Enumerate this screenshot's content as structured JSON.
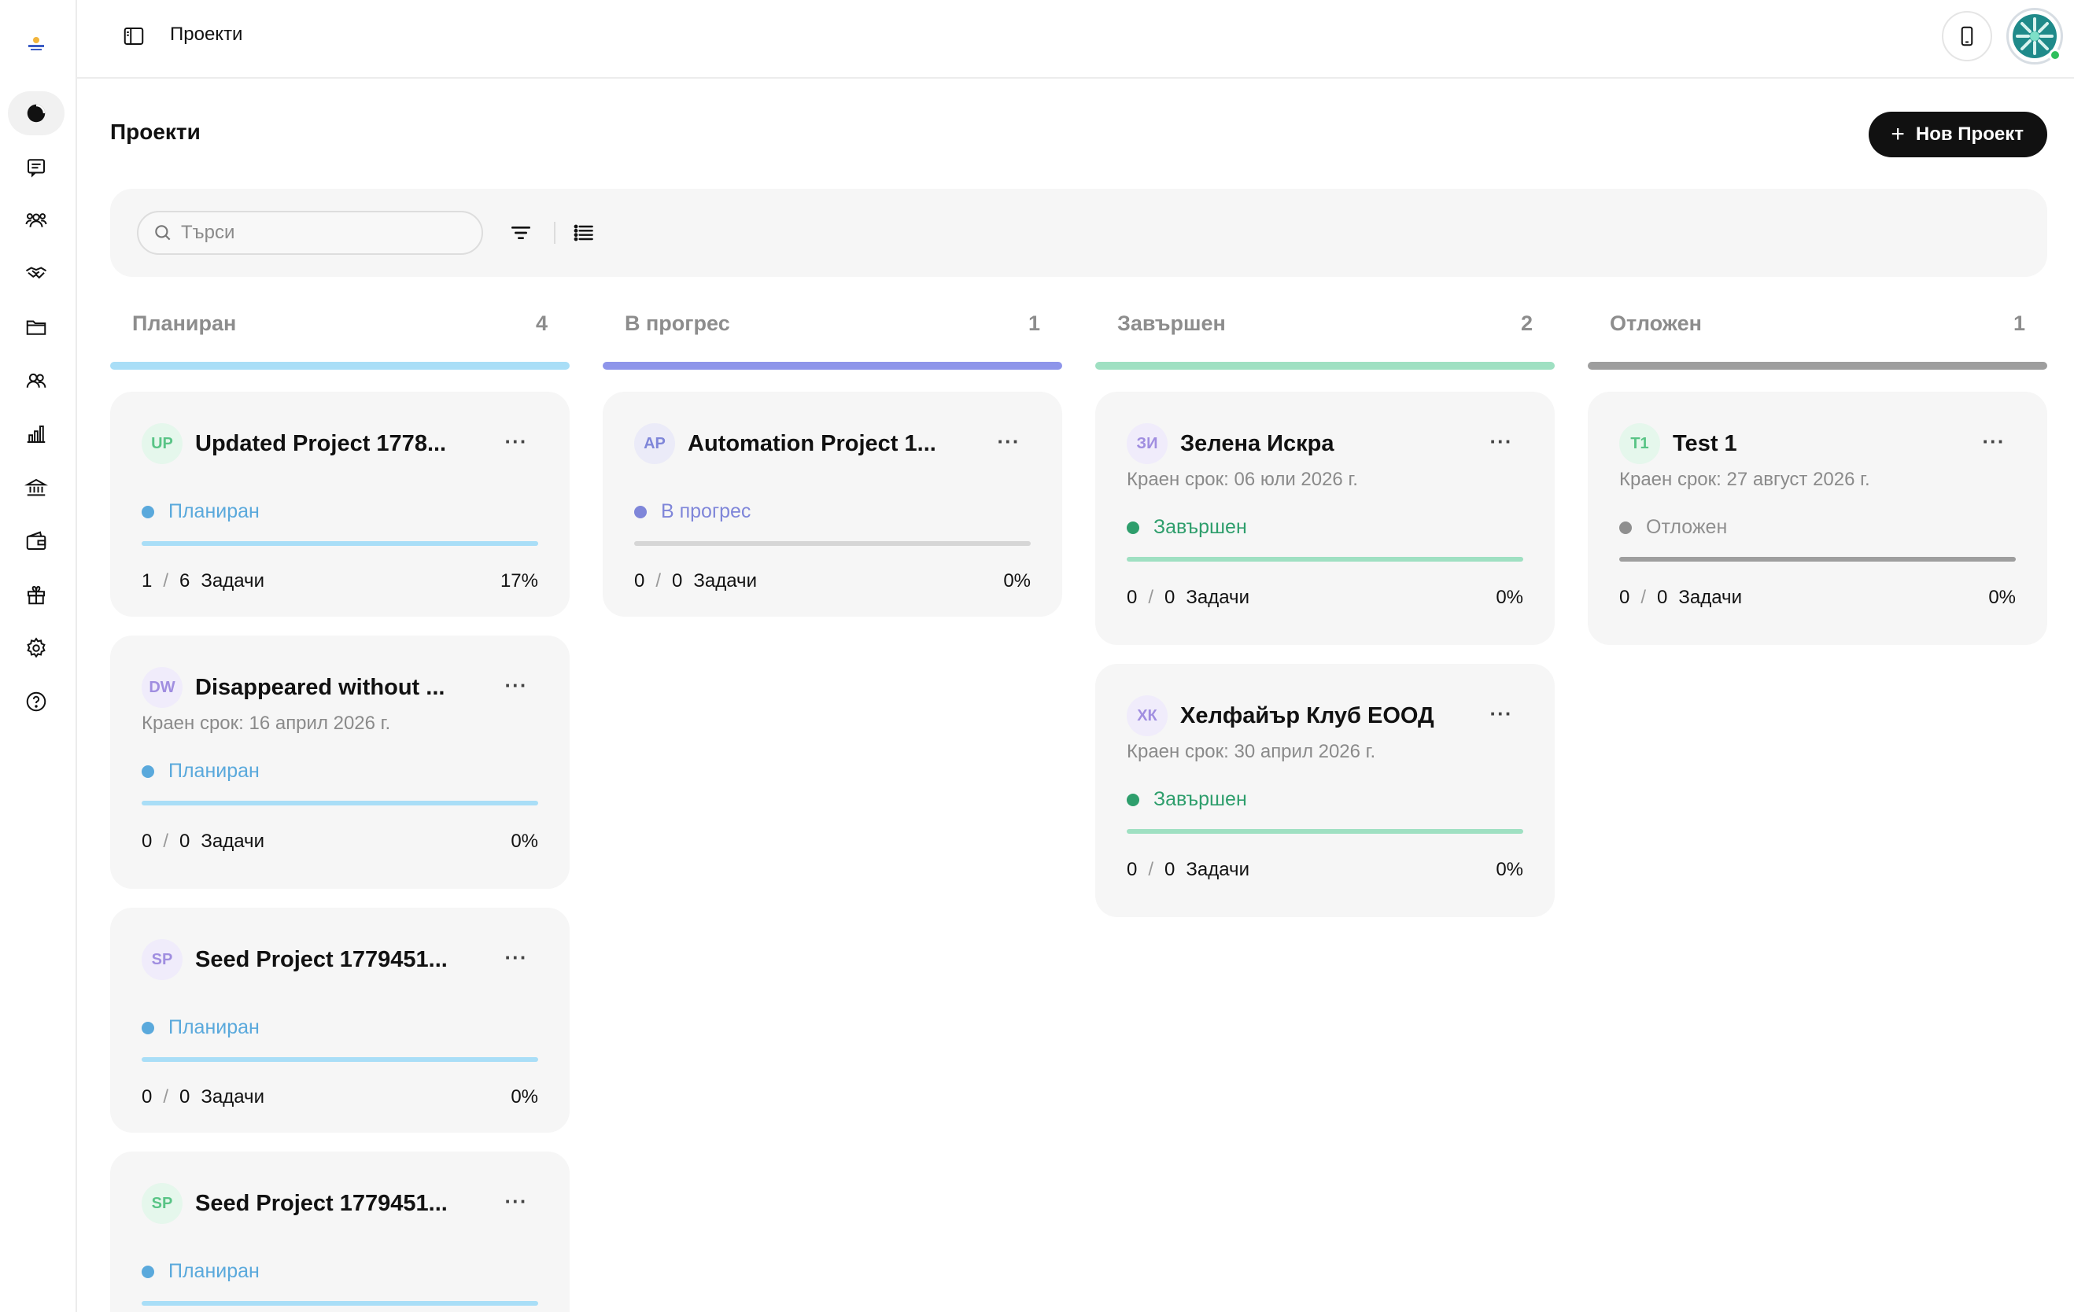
{
  "topbar": {
    "title": "Проекти"
  },
  "page": {
    "title": "Проекти",
    "new_button": "Нов Проект"
  },
  "search": {
    "placeholder": "Търси"
  },
  "colors": {
    "planned": "#5aa9dc",
    "planned_bar": "#a9def7",
    "in_progress": "#7f86d9",
    "in_progress_bar": "#8e95ea",
    "done": "#2e9e6c",
    "done_bar": "#9fe0c2",
    "postponed": "#8f8f8f",
    "postponed_bar": "#9e9e9e"
  },
  "sidebar": {
    "items": [
      {
        "icon": "dashboard-pie-icon",
        "active": true
      },
      {
        "icon": "messages-icon",
        "active": false
      },
      {
        "icon": "team-icon",
        "active": false
      },
      {
        "icon": "handshake-icon",
        "active": false
      },
      {
        "icon": "folder-icon",
        "active": false
      },
      {
        "icon": "users-icon",
        "active": false
      },
      {
        "icon": "bar-chart-icon",
        "active": false
      },
      {
        "icon": "bank-icon",
        "active": false
      },
      {
        "icon": "wallet-icon",
        "active": false
      },
      {
        "icon": "gift-icon",
        "active": false
      },
      {
        "icon": "settings-gear-icon",
        "active": false
      },
      {
        "icon": "help-icon",
        "active": false
      }
    ]
  },
  "columns": [
    {
      "title": "Планиран",
      "count": "4",
      "cards": [
        {
          "initials": "UP",
          "name": "Updated Project 1778...",
          "deadline": "",
          "status": "Планиран",
          "done": "1",
          "total": "6",
          "tasks_label": "Задачи",
          "percent": "17%",
          "progress": 0.17
        },
        {
          "initials": "DW",
          "name": "Disappeared without ...",
          "deadline": "Краен срок: 16 април 2026 г.",
          "status": "Планиран",
          "done": "0",
          "total": "0",
          "tasks_label": "Задачи",
          "percent": "0%",
          "progress": 0
        },
        {
          "initials": "SP",
          "name": "Seed Project 1779451...",
          "deadline": "",
          "status": "Планиран",
          "done": "0",
          "total": "0",
          "tasks_label": "Задачи",
          "percent": "0%",
          "progress": 0
        },
        {
          "initials": "SP",
          "name": "Seed Project 1779451...",
          "deadline": "",
          "status": "Планиран",
          "done": "",
          "total": "",
          "tasks_label": "",
          "percent": "",
          "progress": 0
        }
      ]
    },
    {
      "title": "В прогрес",
      "count": "1",
      "cards": [
        {
          "initials": "AP",
          "name": "Automation Project 1...",
          "deadline": "",
          "status": "В прогрес",
          "done": "0",
          "total": "0",
          "tasks_label": "Задачи",
          "percent": "0%",
          "progress": 0
        }
      ]
    },
    {
      "title": "Завършен",
      "count": "2",
      "cards": [
        {
          "initials": "ЗИ",
          "name": "Зелена Искра",
          "deadline": "Краен срок: 06 юли 2026 г.",
          "status": "Завършен",
          "done": "0",
          "total": "0",
          "tasks_label": "Задачи",
          "percent": "0%",
          "progress": 0
        },
        {
          "initials": "ХК",
          "name": "Хелфайър Клуб ЕООД",
          "deadline": "Краен срок: 30 април 2026 г.",
          "status": "Завършен",
          "done": "0",
          "total": "0",
          "tasks_label": "Задачи",
          "percent": "0%",
          "progress": 0
        }
      ]
    },
    {
      "title": "Отложен",
      "count": "1",
      "cards": [
        {
          "initials": "T1",
          "name": "Test 1",
          "deadline": "Краен срок: 27 август 2026 г.",
          "status": "Отложен",
          "done": "0",
          "total": "0",
          "tasks_label": "Задачи",
          "percent": "0%",
          "progress": 0
        }
      ]
    }
  ]
}
